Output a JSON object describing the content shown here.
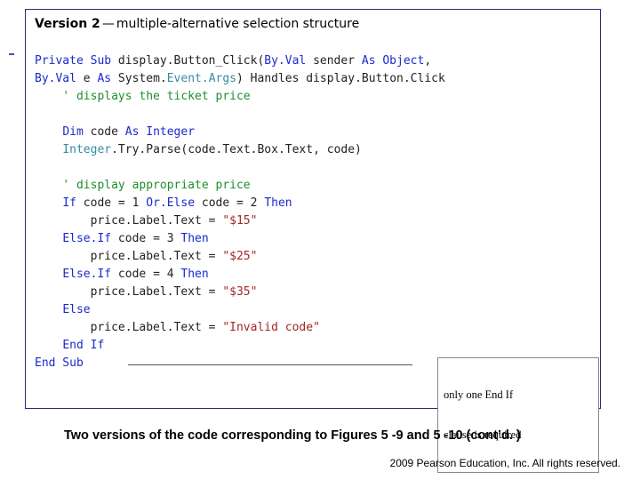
{
  "heading": {
    "strong": "Version 2",
    "dash": "—",
    "rest": "multiple-alternative selection structure"
  },
  "code": {
    "l1a": "Private Sub",
    "l1b": " display.Button_Click(",
    "l1c": "By.Val",
    "l1d": " sender ",
    "l1e": "As Object",
    "l1f": ",",
    "l2a": "By.Val",
    "l2b": " e ",
    "l2c": "As",
    "l2d": " System.",
    "l2e": "Event.Args",
    "l2f": ") Handles display.Button.Click",
    "l3": "    ' displays the ticket price",
    "l4": "",
    "l5a": "    ",
    "l5b": "Dim",
    "l5c": " code ",
    "l5d": "As Integer",
    "l6a": "    ",
    "l6b": "Integer",
    "l6c": ".Try.Parse(code.Text.Box.Text, code)",
    "l7": "",
    "l8": "    ' display appropriate price",
    "l9a": "    ",
    "l9b": "If",
    "l9c": " code = 1 ",
    "l9d": "Or.Else",
    "l9e": " code = 2 ",
    "l9f": "Then",
    "l10a": "        price.Label.Text = ",
    "l10b": "\"$15\"",
    "l11a": "    ",
    "l11b": "Else.If",
    "l11c": " code = 3 ",
    "l11d": "Then",
    "l12a": "        price.Label.Text = ",
    "l12b": "\"$25\"",
    "l13a": "    ",
    "l13b": "Else.If",
    "l13c": " code = 4 ",
    "l13d": "Then",
    "l14a": "        price.Label.Text = ",
    "l14b": "\"$35\"",
    "l15a": "    ",
    "l15b": "Else",
    "l16a": "        price.Label.Text = ",
    "l16b": "\"Invalid code\"",
    "l17a": "    ",
    "l17b": "End If",
    "l18": "End Sub"
  },
  "annotation": {
    "line1": "only one End If",
    "line2": "clause is required"
  },
  "caption": "Two versions of the code corresponding to Figures 5 -9 and 5 -10 (cont’d. )",
  "copyright": "  2009 Pearson Education, Inc.  All rights reserved."
}
